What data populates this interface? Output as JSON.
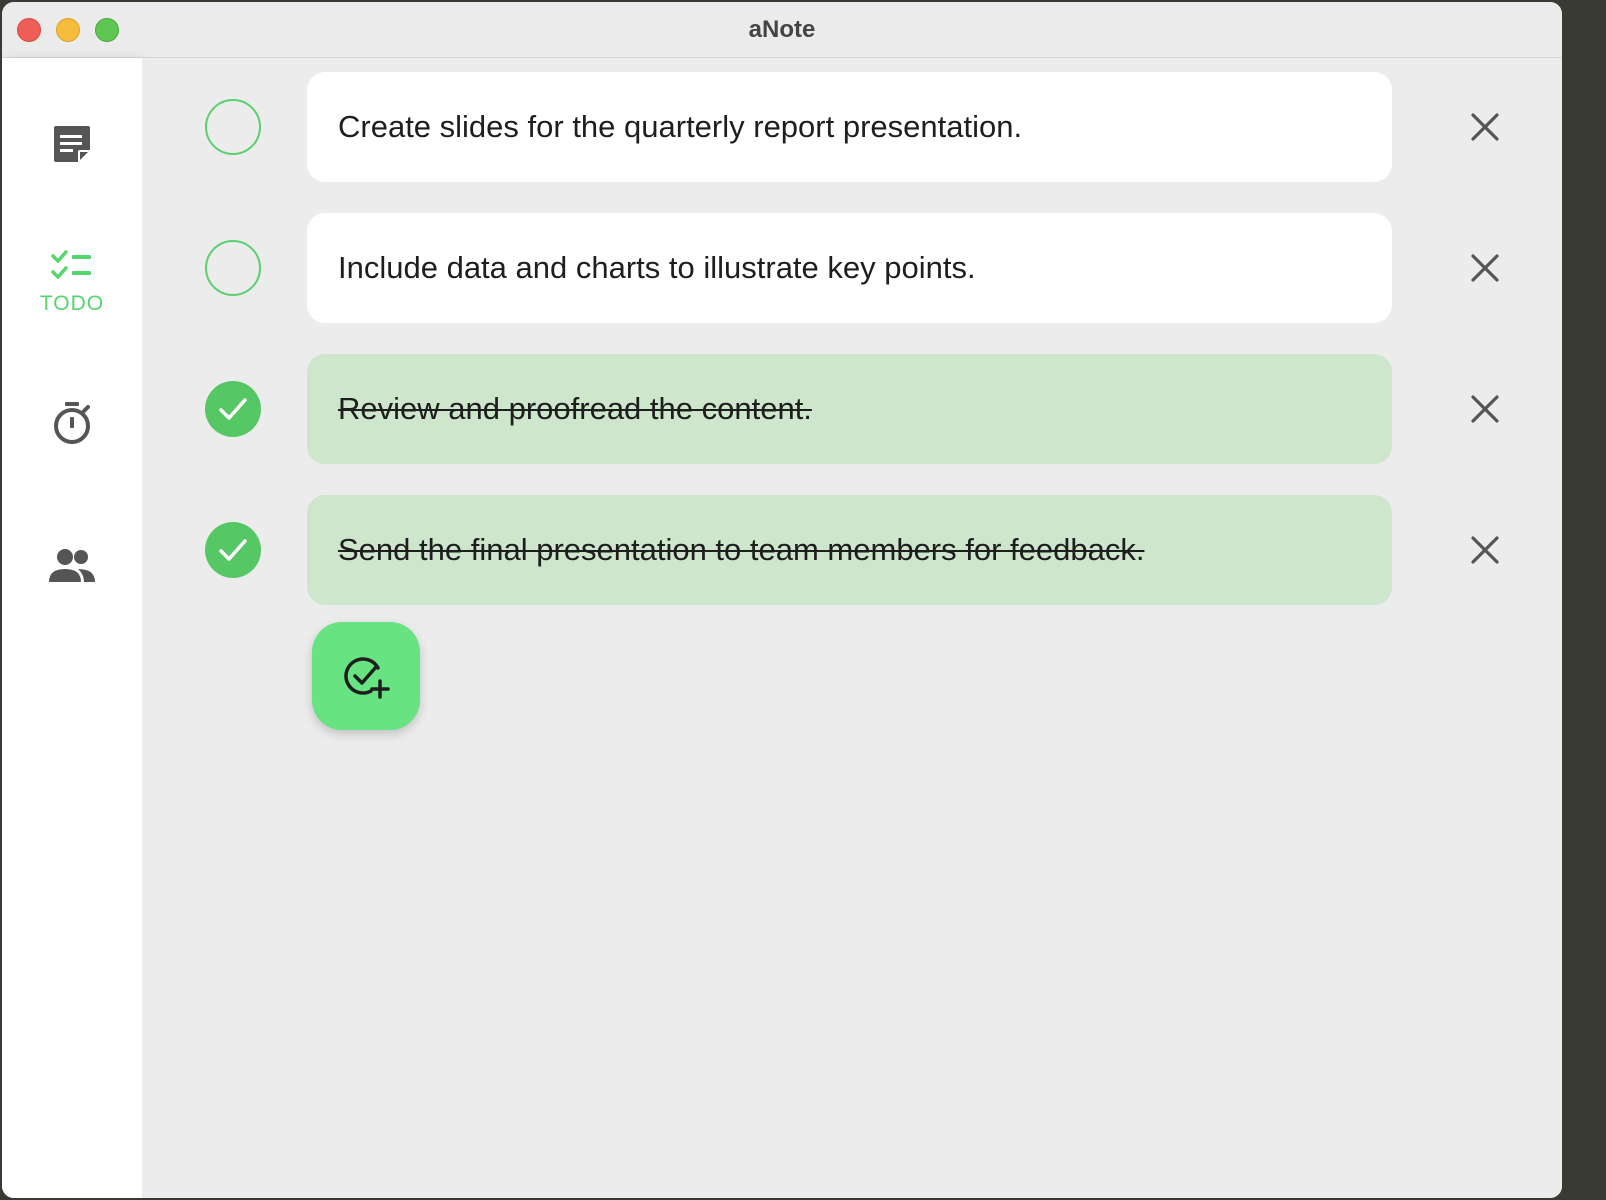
{
  "window": {
    "title": "aNote"
  },
  "sidebar": {
    "items": [
      {
        "id": "notes",
        "icon": "note-icon",
        "label": "",
        "active": false
      },
      {
        "id": "todo",
        "icon": "checklist-icon",
        "label": "TODO",
        "active": true
      },
      {
        "id": "timer",
        "icon": "stopwatch-icon",
        "label": "",
        "active": false
      },
      {
        "id": "people",
        "icon": "people-icon",
        "label": "",
        "active": false
      }
    ]
  },
  "todos": [
    {
      "text": "Create slides for the quarterly report presentation.",
      "done": false
    },
    {
      "text": "Include data and charts to illustrate key points.",
      "done": false
    },
    {
      "text": "Review and proofread the content.",
      "done": true
    },
    {
      "text": "Send the final presentation to team members for feedback.",
      "done": true
    }
  ],
  "add_button": {
    "icon": "add-task-icon"
  },
  "colors": {
    "accent": "#55d46f",
    "done_card": "#cde6cc",
    "check_fill": "#55c765",
    "fab": "#67e382"
  }
}
